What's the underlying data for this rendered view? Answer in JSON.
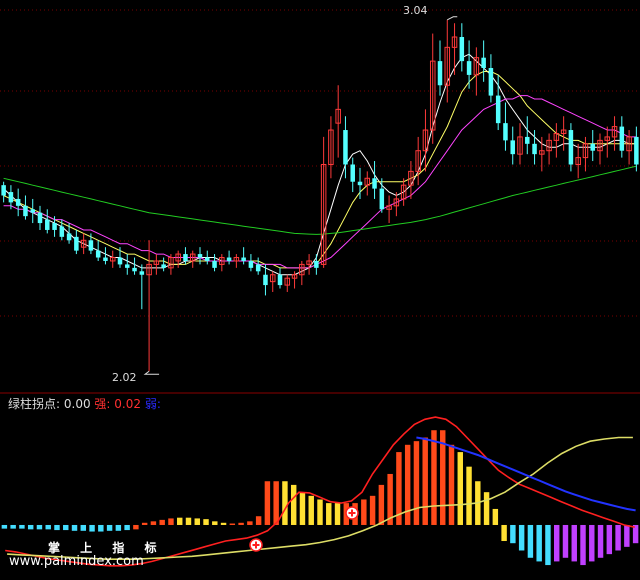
{
  "chart_data": [
    {
      "type": "candlestick",
      "price_high_label": "3.04",
      "price_low_label": "2.02",
      "ylim": [
        1.98,
        3.08
      ],
      "up_color": "#ff3a3a",
      "down_color": "#54ffff",
      "candles": [
        [
          2.56,
          2.57,
          2.51,
          2.53
        ],
        [
          2.54,
          2.56,
          2.49,
          2.51
        ],
        [
          2.52,
          2.55,
          2.47,
          2.5
        ],
        [
          2.5,
          2.53,
          2.46,
          2.47
        ],
        [
          2.49,
          2.52,
          2.45,
          2.48
        ],
        [
          2.48,
          2.5,
          2.43,
          2.45
        ],
        [
          2.46,
          2.49,
          2.42,
          2.43
        ],
        [
          2.45,
          2.47,
          2.41,
          2.43
        ],
        [
          2.44,
          2.46,
          2.4,
          2.41
        ],
        [
          2.42,
          2.45,
          2.39,
          2.4
        ],
        [
          2.41,
          2.43,
          2.36,
          2.37
        ],
        [
          2.38,
          2.42,
          2.36,
          2.4
        ],
        [
          2.4,
          2.42,
          2.36,
          2.37
        ],
        [
          2.37,
          2.4,
          2.34,
          2.35
        ],
        [
          2.35,
          2.38,
          2.33,
          2.34
        ],
        [
          2.34,
          2.37,
          2.32,
          2.35
        ],
        [
          2.35,
          2.38,
          2.32,
          2.33
        ],
        [
          2.33,
          2.36,
          2.3,
          2.32
        ],
        [
          2.32,
          2.35,
          2.3,
          2.31
        ],
        [
          2.31,
          2.33,
          2.2,
          2.3
        ],
        [
          2.3,
          2.4,
          2.02,
          2.33
        ],
        [
          2.33,
          2.36,
          2.3,
          2.34
        ],
        [
          2.33,
          2.35,
          2.31,
          2.32
        ],
        [
          2.32,
          2.36,
          2.3,
          2.35
        ],
        [
          2.34,
          2.37,
          2.32,
          2.36
        ],
        [
          2.36,
          2.38,
          2.33,
          2.34
        ],
        [
          2.34,
          2.37,
          2.32,
          2.36
        ],
        [
          2.36,
          2.38,
          2.33,
          2.35
        ],
        [
          2.35,
          2.37,
          2.33,
          2.34
        ],
        [
          2.34,
          2.36,
          2.31,
          2.32
        ],
        [
          2.33,
          2.36,
          2.31,
          2.35
        ],
        [
          2.35,
          2.37,
          2.33,
          2.34
        ],
        [
          2.34,
          2.36,
          2.32,
          2.35
        ],
        [
          2.35,
          2.38,
          2.33,
          2.34
        ],
        [
          2.34,
          2.36,
          2.31,
          2.32
        ],
        [
          2.33,
          2.35,
          2.3,
          2.31
        ],
        [
          2.3,
          2.33,
          2.24,
          2.27
        ],
        [
          2.28,
          2.31,
          2.25,
          2.3
        ],
        [
          2.3,
          2.32,
          2.26,
          2.27
        ],
        [
          2.27,
          2.3,
          2.25,
          2.29
        ],
        [
          2.29,
          2.31,
          2.26,
          2.3
        ],
        [
          2.3,
          2.34,
          2.27,
          2.33
        ],
        [
          2.33,
          2.36,
          2.3,
          2.34
        ],
        [
          2.34,
          2.36,
          2.3,
          2.32
        ],
        [
          2.33,
          2.7,
          2.32,
          2.62
        ],
        [
          2.62,
          2.76,
          2.58,
          2.72
        ],
        [
          2.74,
          2.85,
          2.64,
          2.78
        ],
        [
          2.72,
          2.76,
          2.58,
          2.62
        ],
        [
          2.62,
          2.64,
          2.54,
          2.57
        ],
        [
          2.57,
          2.61,
          2.52,
          2.56
        ],
        [
          2.56,
          2.6,
          2.53,
          2.58
        ],
        [
          2.58,
          2.63,
          2.52,
          2.55
        ],
        [
          2.55,
          2.58,
          2.48,
          2.49
        ],
        [
          2.49,
          2.53,
          2.45,
          2.5
        ],
        [
          2.5,
          2.54,
          2.47,
          2.52
        ],
        [
          2.52,
          2.58,
          2.5,
          2.56
        ],
        [
          2.56,
          2.63,
          2.52,
          2.6
        ],
        [
          2.6,
          2.7,
          2.56,
          2.66
        ],
        [
          2.66,
          2.78,
          2.6,
          2.72
        ],
        [
          2.72,
          3.0,
          2.68,
          2.92
        ],
        [
          2.92,
          2.98,
          2.82,
          2.85
        ],
        [
          2.85,
          3.04,
          2.8,
          2.96
        ],
        [
          2.96,
          3.03,
          2.88,
          2.99
        ],
        [
          2.99,
          3.03,
          2.89,
          2.92
        ],
        [
          2.92,
          2.98,
          2.84,
          2.88
        ],
        [
          2.88,
          2.96,
          2.82,
          2.93
        ],
        [
          2.93,
          2.98,
          2.86,
          2.9
        ],
        [
          2.9,
          2.94,
          2.8,
          2.82
        ],
        [
          2.82,
          2.88,
          2.72,
          2.74
        ],
        [
          2.74,
          2.8,
          2.66,
          2.69
        ],
        [
          2.69,
          2.73,
          2.62,
          2.65
        ],
        [
          2.65,
          2.74,
          2.62,
          2.7
        ],
        [
          2.7,
          2.76,
          2.65,
          2.68
        ],
        [
          2.68,
          2.72,
          2.62,
          2.65
        ],
        [
          2.65,
          2.7,
          2.6,
          2.66
        ],
        [
          2.66,
          2.71,
          2.62,
          2.69
        ],
        [
          2.69,
          2.74,
          2.64,
          2.71
        ],
        [
          2.71,
          2.76,
          2.66,
          2.72
        ],
        [
          2.72,
          2.74,
          2.6,
          2.62
        ],
        [
          2.62,
          2.68,
          2.58,
          2.64
        ],
        [
          2.64,
          2.7,
          2.6,
          2.68
        ],
        [
          2.68,
          2.72,
          2.63,
          2.66
        ],
        [
          2.66,
          2.71,
          2.62,
          2.69
        ],
        [
          2.69,
          2.73,
          2.64,
          2.7
        ],
        [
          2.7,
          2.76,
          2.66,
          2.73
        ],
        [
          2.73,
          2.76,
          2.64,
          2.66
        ],
        [
          2.66,
          2.72,
          2.62,
          2.7
        ],
        [
          2.7,
          2.73,
          2.6,
          2.62
        ]
      ],
      "series": [
        {
          "color": "#ffffff",
          "values": [
            2.55,
            2.53,
            2.51,
            2.49,
            2.48,
            2.47,
            2.46,
            2.45,
            2.44,
            2.42,
            2.4,
            2.39,
            2.38,
            2.37,
            2.36,
            2.35,
            2.35,
            2.34,
            2.33,
            2.32,
            2.32,
            2.32,
            2.32,
            2.33,
            2.33,
            2.34,
            2.34,
            2.35,
            2.35,
            2.35,
            2.34,
            2.34,
            2.34,
            2.34,
            2.34,
            2.33,
            2.32,
            2.31,
            2.3,
            2.3,
            2.3,
            2.31,
            2.32,
            2.35,
            2.42,
            2.49,
            2.56,
            2.62,
            2.65,
            2.66,
            2.63,
            2.59,
            2.56,
            2.54,
            2.53,
            2.54,
            2.56,
            2.6,
            2.65,
            2.73,
            2.8,
            2.86,
            2.9,
            2.93,
            2.94,
            2.92,
            2.9,
            2.88,
            2.85,
            2.81,
            2.78,
            2.75,
            2.72,
            2.7,
            2.68,
            2.67,
            2.67,
            2.68,
            2.68,
            2.67,
            2.67,
            2.67,
            2.67,
            2.68,
            2.69,
            2.69,
            2.68,
            2.68
          ]
        },
        {
          "color": "#ffff66",
          "values": [
            2.53,
            2.52,
            2.51,
            2.5,
            2.49,
            2.48,
            2.47,
            2.46,
            2.45,
            2.44,
            2.43,
            2.42,
            2.41,
            2.4,
            2.39,
            2.38,
            2.37,
            2.36,
            2.36,
            2.35,
            2.34,
            2.34,
            2.34,
            2.33,
            2.33,
            2.33,
            2.34,
            2.34,
            2.34,
            2.34,
            2.34,
            2.34,
            2.34,
            2.34,
            2.34,
            2.34,
            2.33,
            2.33,
            2.32,
            2.32,
            2.32,
            2.32,
            2.32,
            2.33,
            2.36,
            2.39,
            2.43,
            2.47,
            2.51,
            2.54,
            2.56,
            2.57,
            2.57,
            2.57,
            2.57,
            2.57,
            2.58,
            2.59,
            2.61,
            2.65,
            2.69,
            2.73,
            2.78,
            2.83,
            2.86,
            2.88,
            2.89,
            2.89,
            2.88,
            2.86,
            2.84,
            2.82,
            2.79,
            2.77,
            2.75,
            2.73,
            2.71,
            2.7,
            2.69,
            2.69,
            2.68,
            2.68,
            2.68,
            2.68,
            2.68,
            2.68,
            2.68,
            2.68
          ]
        },
        {
          "color": "#ff44ff",
          "values": [
            2.5,
            2.5,
            2.49,
            2.49,
            2.48,
            2.48,
            2.47,
            2.46,
            2.46,
            2.45,
            2.44,
            2.43,
            2.43,
            2.42,
            2.41,
            2.4,
            2.39,
            2.39,
            2.38,
            2.37,
            2.37,
            2.36,
            2.36,
            2.35,
            2.35,
            2.35,
            2.35,
            2.35,
            2.34,
            2.34,
            2.34,
            2.34,
            2.34,
            2.34,
            2.34,
            2.33,
            2.33,
            2.33,
            2.33,
            2.32,
            2.32,
            2.32,
            2.32,
            2.33,
            2.34,
            2.35,
            2.37,
            2.39,
            2.41,
            2.43,
            2.45,
            2.47,
            2.49,
            2.5,
            2.51,
            2.52,
            2.53,
            2.55,
            2.57,
            2.6,
            2.63,
            2.66,
            2.69,
            2.72,
            2.74,
            2.76,
            2.78,
            2.79,
            2.8,
            2.81,
            2.81,
            2.82,
            2.82,
            2.81,
            2.81,
            2.8,
            2.79,
            2.78,
            2.77,
            2.76,
            2.75,
            2.74,
            2.73,
            2.72,
            2.72,
            2.71,
            2.7,
            2.7
          ]
        },
        {
          "color": "#22cc22",
          "values": [
            2.58,
            2.575,
            2.57,
            2.565,
            2.56,
            2.555,
            2.55,
            2.545,
            2.54,
            2.535,
            2.53,
            2.525,
            2.52,
            2.515,
            2.51,
            2.505,
            2.5,
            2.495,
            2.49,
            2.485,
            2.48,
            2.477,
            2.474,
            2.471,
            2.468,
            2.465,
            2.462,
            2.459,
            2.456,
            2.453,
            2.45,
            2.447,
            2.444,
            2.441,
            2.438,
            2.435,
            2.432,
            2.429,
            2.426,
            2.423,
            2.42,
            2.419,
            2.418,
            2.417,
            2.418,
            2.42,
            2.422,
            2.425,
            2.428,
            2.431,
            2.434,
            2.437,
            2.44,
            2.443,
            2.446,
            2.449,
            2.452,
            2.456,
            2.46,
            2.465,
            2.47,
            2.476,
            2.482,
            2.488,
            2.494,
            2.5,
            2.506,
            2.512,
            2.518,
            2.524,
            2.53,
            2.535,
            2.54,
            2.545,
            2.55,
            2.555,
            2.56,
            2.565,
            2.57,
            2.575,
            2.58,
            2.585,
            2.59,
            2.595,
            2.6,
            2.605,
            2.61,
            2.615
          ]
        }
      ]
    },
    {
      "type": "bar",
      "legend": {
        "label": "绿柱拐点:",
        "label_value": "0.00",
        "strong_label": "强:",
        "strong_value": "0.02",
        "weak_label": "弱:"
      },
      "ylim": [
        -0.07,
        0.155
      ],
      "colors": {
        "red": "#ff4a1a",
        "yellow": "#ffe033",
        "cyan": "#44ddff",
        "purple": "#c040ff"
      },
      "values": [
        -0.005,
        -0.005,
        -0.005,
        -0.006,
        -0.006,
        -0.006,
        -0.007,
        -0.007,
        -0.008,
        -0.008,
        -0.009,
        -0.009,
        -0.008,
        -0.008,
        -0.007,
        -0.006,
        0.003,
        0.005,
        0.007,
        0.009,
        0.01,
        0.01,
        0.009,
        0.008,
        0.005,
        0.003,
        0.002,
        0.003,
        0.005,
        0.012,
        0.06,
        0.06,
        0.06,
        0.055,
        0.045,
        0.04,
        0.035,
        0.03,
        0.03,
        0.03,
        0.03,
        0.035,
        0.04,
        0.055,
        0.07,
        0.1,
        0.11,
        0.115,
        0.12,
        0.13,
        0.13,
        0.11,
        0.1,
        0.08,
        0.06,
        0.045,
        0.022,
        -0.022,
        -0.025,
        -0.035,
        -0.045,
        -0.05,
        -0.055,
        -0.05,
        -0.045,
        -0.05,
        -0.055,
        -0.05,
        -0.045,
        -0.04,
        -0.035,
        -0.03,
        -0.025
      ],
      "bar_color_codes": "cccccccccccccccrrrrryyyyyyrrrrrryyyyyyyrrrrrrrrrrrrryyyyyycccccppppppppppp",
      "series": [
        {
          "color": "#ff2020",
          "values": [
            -0.035,
            -0.037,
            -0.04,
            -0.043,
            -0.046,
            -0.048,
            -0.05,
            -0.052,
            -0.054,
            -0.055,
            -0.056,
            -0.056,
            -0.055,
            -0.053,
            -0.05,
            -0.046,
            -0.042,
            -0.038,
            -0.034,
            -0.03,
            -0.026,
            -0.022,
            -0.02,
            -0.018,
            -0.014,
            -0.008,
            0.005,
            0.03,
            0.045,
            0.044,
            0.038,
            0.032,
            0.03,
            0.033,
            0.045,
            0.07,
            0.09,
            0.11,
            0.125,
            0.138,
            0.145,
            0.148,
            0.145,
            0.135,
            0.12,
            0.105,
            0.09,
            0.075,
            0.065,
            0.056,
            0.05,
            0.044,
            0.038,
            0.032,
            0.026,
            0.02,
            0.015,
            0.01,
            0.005,
            0.0,
            -0.003
          ]
        },
        {
          "color": "#dddd66",
          "values": [
            -0.04,
            -0.041,
            -0.042,
            -0.043,
            -0.044,
            -0.045,
            -0.046,
            -0.047,
            -0.047,
            -0.047,
            -0.046,
            -0.045,
            -0.044,
            -0.043,
            -0.041,
            -0.039,
            -0.037,
            -0.035,
            -0.033,
            -0.031,
            -0.029,
            -0.027,
            -0.024,
            -0.02,
            -0.015,
            -0.008,
            0.0,
            0.01,
            0.018,
            0.024,
            0.026,
            0.027,
            0.028,
            0.03,
            0.036,
            0.045,
            0.058,
            0.07,
            0.085,
            0.098,
            0.108,
            0.115,
            0.118,
            0.12,
            0.12
          ]
        },
        {
          "color": "#2233ff",
          "values": [
            0.12,
            0.118,
            0.115,
            0.112,
            0.108,
            0.104,
            0.1,
            0.096,
            0.091,
            0.086,
            0.081,
            0.076,
            0.071,
            0.066,
            0.061,
            0.056,
            0.051,
            0.046,
            0.042,
            0.038,
            0.034,
            0.031,
            0.028,
            0.025,
            0.022,
            0.02
          ]
        }
      ],
      "markers": [
        {
          "symbol": "+",
          "index": 24
        },
        {
          "symbol": "+",
          "index": 31
        }
      ]
    }
  ],
  "watermark": {
    "title": "掌 上 指 标",
    "url": "www.palmindex.com"
  }
}
